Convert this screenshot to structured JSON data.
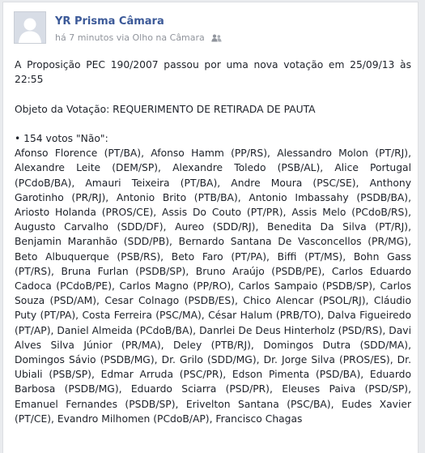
{
  "post": {
    "author": "YR Prisma Câmara",
    "time": "há 7 minutos",
    "via": "via",
    "source": "Olho na Câmara",
    "audience_icon": "friends-icon",
    "intro": "A Proposição PEC 190/2007 passou por uma nova votação em 25/09/13 às 22:55",
    "objective": "Objeto da Votação: REQUERIMENTO DE RETIRADA DE PAUTA",
    "votes_header": "• 154 votos \"Não\":",
    "votes_list": "Afonso Florence (PT/BA), Afonso Hamm (PP/RS), Alessandro Molon (PT/RJ), Alexandre Leite (DEM/SP), Alexandre Toledo (PSB/AL), Alice Portugal (PCdoB/BA), Amauri Teixeira (PT/BA), Andre Moura (PSC/SE), Anthony Garotinho (PR/RJ), Antonio Brito (PTB/BA), Antonio Imbassahy (PSDB/BA), Ariosto Holanda (PROS/CE), Assis Do Couto (PT/PR), Assis Melo (PCdoB/RS), Augusto Carvalho (SDD/DF), Aureo (SDD/RJ), Benedita Da Silva (PT/RJ), Benjamin Maranhão (SDD/PB), Bernardo Santana De Vasconcellos (PR/MG), Beto Albuquerque (PSB/RS), Beto Faro (PT/PA), Biffi (PT/MS), Bohn Gass (PT/RS), Bruna Furlan (PSDB/SP), Bruno Araújo (PSDB/PE), Carlos Eduardo Cadoca (PCdoB/PE), Carlos Magno (PP/RO), Carlos Sampaio (PSDB/SP), Carlos Souza (PSD/AM), Cesar Colnago (PSDB/ES), Chico Alencar (PSOL/RJ), Cláudio Puty (PT/PA), Costa Ferreira (PSC/MA), César Halum (PRB/TO), Dalva Figueiredo (PT/AP), Daniel Almeida (PCdoB/BA), Danrlei De Deus Hinterholz (PSD/RS), Davi Alves Silva Júnior (PR/MA), Deley (PTB/RJ), Domingos Dutra (SDD/MA), Domingos Sávio (PSDB/MG), Dr. Grilo (SDD/MG), Dr. Jorge Silva (PROS/ES), Dr. Ubiali (PSB/SP), Edmar Arruda (PSC/PR), Edson Pimenta (PSD/BA), Eduardo Barbosa (PSDB/MG), Eduardo Sciarra (PSD/PR), Eleuses Paiva (PSD/SP), Emanuel Fernandes (PSDB/SP), Erivelton Santana (PSC/BA), Eudes Xavier (PT/CE), Evandro Milhomen (PCdoB/AP), Francisco Chagas"
  },
  "colors": {
    "link": "#3b5998",
    "text": "#1d2129",
    "meta": "#90949c"
  }
}
